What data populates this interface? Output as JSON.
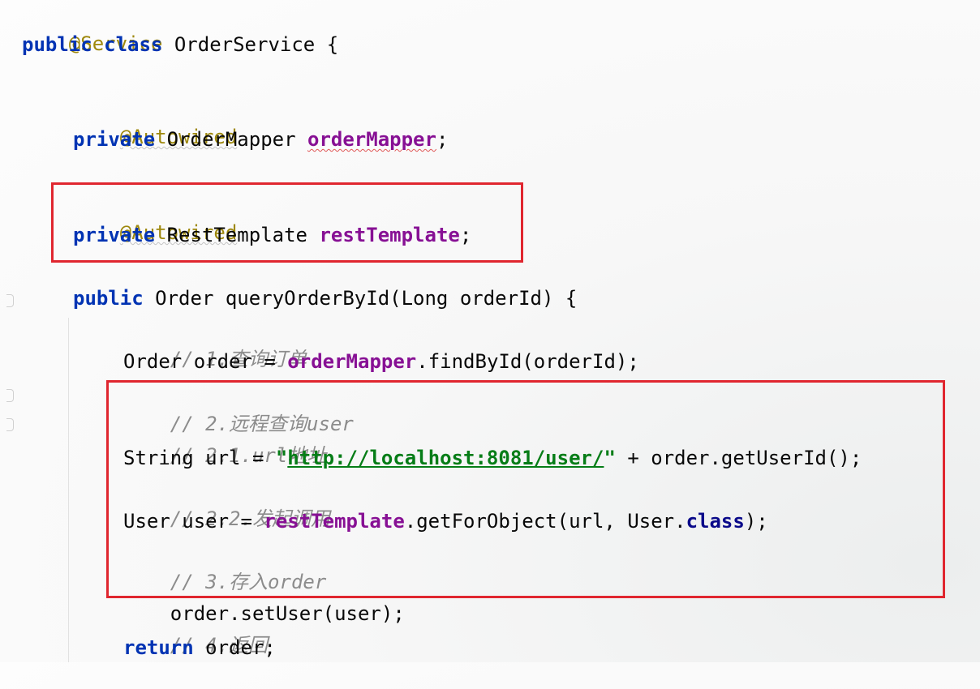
{
  "code": {
    "l1": {
      "annotation": "@Service"
    },
    "l2": {
      "kw1": "public",
      "kw2": "class",
      "rest": " OrderService {"
    },
    "l4": {
      "annotation": "@Autowired"
    },
    "l5": {
      "kw": "private",
      "type": " OrderMapper ",
      "field": "orderMapper",
      "end": ";"
    },
    "l7": {
      "annotation": "@Autowired"
    },
    "l8": {
      "kw": "private",
      "type": " RestTemplate ",
      "field": "restTemplate",
      "end": ";"
    },
    "l10": {
      "kw": "public",
      "rest": " Order queryOrderById(Long orderId) {"
    },
    "l11": {
      "comment": "// 1.查询订单"
    },
    "l12": {
      "pre": "Order order = ",
      "field": "orderMapper",
      "post": ".findById(orderId);"
    },
    "l13": {
      "comment": "// 2.远程查询user"
    },
    "l14": {
      "comment": "// 2.1.url地址"
    },
    "l15": {
      "pre": "String url = ",
      "q1": "\"",
      "url": "http://localhost:8081/user/",
      "q2": "\"",
      "post": " + order.getUserId();"
    },
    "l16": {
      "comment": "// 2.2.发起调用"
    },
    "l17": {
      "pre": "User user = ",
      "field": "restTemplate",
      "mid": ".getForObject(url, User.",
      "kw": "class",
      "post": ");"
    },
    "l18": {
      "comment": "// 3.存入order"
    },
    "l19": {
      "text": "order.setUser(user);"
    },
    "l20": {
      "comment": "// 4.返回"
    },
    "l21": {
      "kw": "return",
      "rest": " order;"
    }
  },
  "colors": {
    "highlight_box": "#e0262f",
    "keyword": "#0033b3",
    "annotation": "#9e880d",
    "field": "#871094",
    "comment": "#8c8c8c",
    "string": "#067d17"
  }
}
